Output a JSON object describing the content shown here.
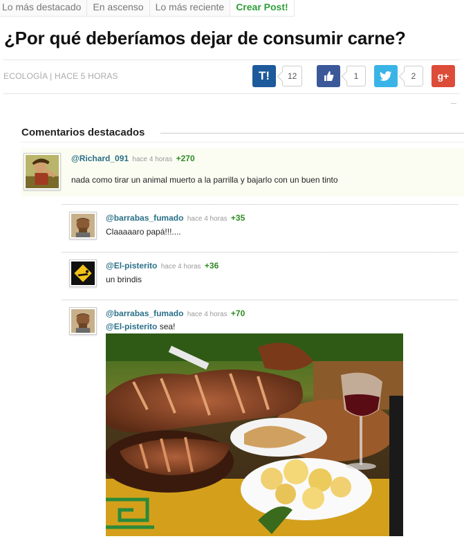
{
  "tabs": [
    "Lo más destacado",
    "En ascenso",
    "Lo más reciente",
    "Crear Post!"
  ],
  "post": {
    "title": "¿Por qué deberíamos dejar de consumir carne?",
    "meta": "ECOLOGÍA | HACE 5 HORAS"
  },
  "share": {
    "taringa": {
      "label": "T!",
      "count": "12",
      "color": "#1d5a9b"
    },
    "facebook": {
      "icon": "thumbs-up-icon",
      "count": "1",
      "color": "#3b5998"
    },
    "twitter": {
      "icon": "bird-icon",
      "count": "2",
      "color": "#3ab4e6"
    },
    "google": {
      "label": "g+",
      "color": "#dd4b39"
    }
  },
  "comments_section": {
    "title": "Comentarios destacados"
  },
  "comments": [
    {
      "user": "@Richard_091",
      "time": "hace 4 horas",
      "score": "+270",
      "text": "nada como tirar un animal muerto a la parrilla y bajarlo con un buen tinto"
    },
    {
      "user": "@barrabas_fumado",
      "time": "hace 4 horas",
      "score": "+35",
      "text": "Claaaaaro papá!!!...."
    },
    {
      "user": "@El-pisterito",
      "time": "hace 4 horas",
      "score": "+36",
      "text": "un brindis"
    },
    {
      "user": "@barrabas_fumado",
      "time": "hace 4 horas",
      "score": "+70",
      "mention": "@El-pisterito",
      "text": " sea!"
    }
  ],
  "colors": {
    "link": "#2a6f87",
    "score": "#2e8b22",
    "create": "#2f9e3a"
  }
}
